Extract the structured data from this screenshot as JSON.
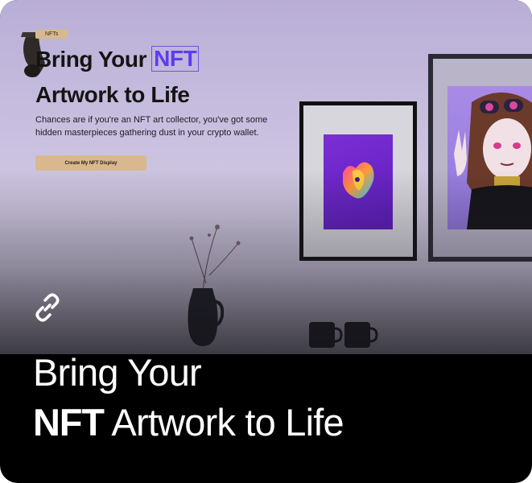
{
  "preview": {
    "badge": "NFTs",
    "headline_part1": "Bring Your",
    "headline_highlight": "NFT",
    "headline_part2": "Artwork to Life",
    "description": "Chances are if you're an NFT art collector, you've got some hidden masterpieces gathering dust in your crypto wallet.",
    "cta_label": "Create My NFT Display"
  },
  "caption": {
    "line1": "Bring Your",
    "line2_strong": "NFT",
    "line2_rest": " Artwork to Life"
  },
  "colors": {
    "highlight": "#5b3df0",
    "cta_bg": "#d8b98e",
    "caption_bg": "#000000",
    "caption_text": "#ffffff"
  },
  "icons": {
    "link": "link-icon"
  }
}
